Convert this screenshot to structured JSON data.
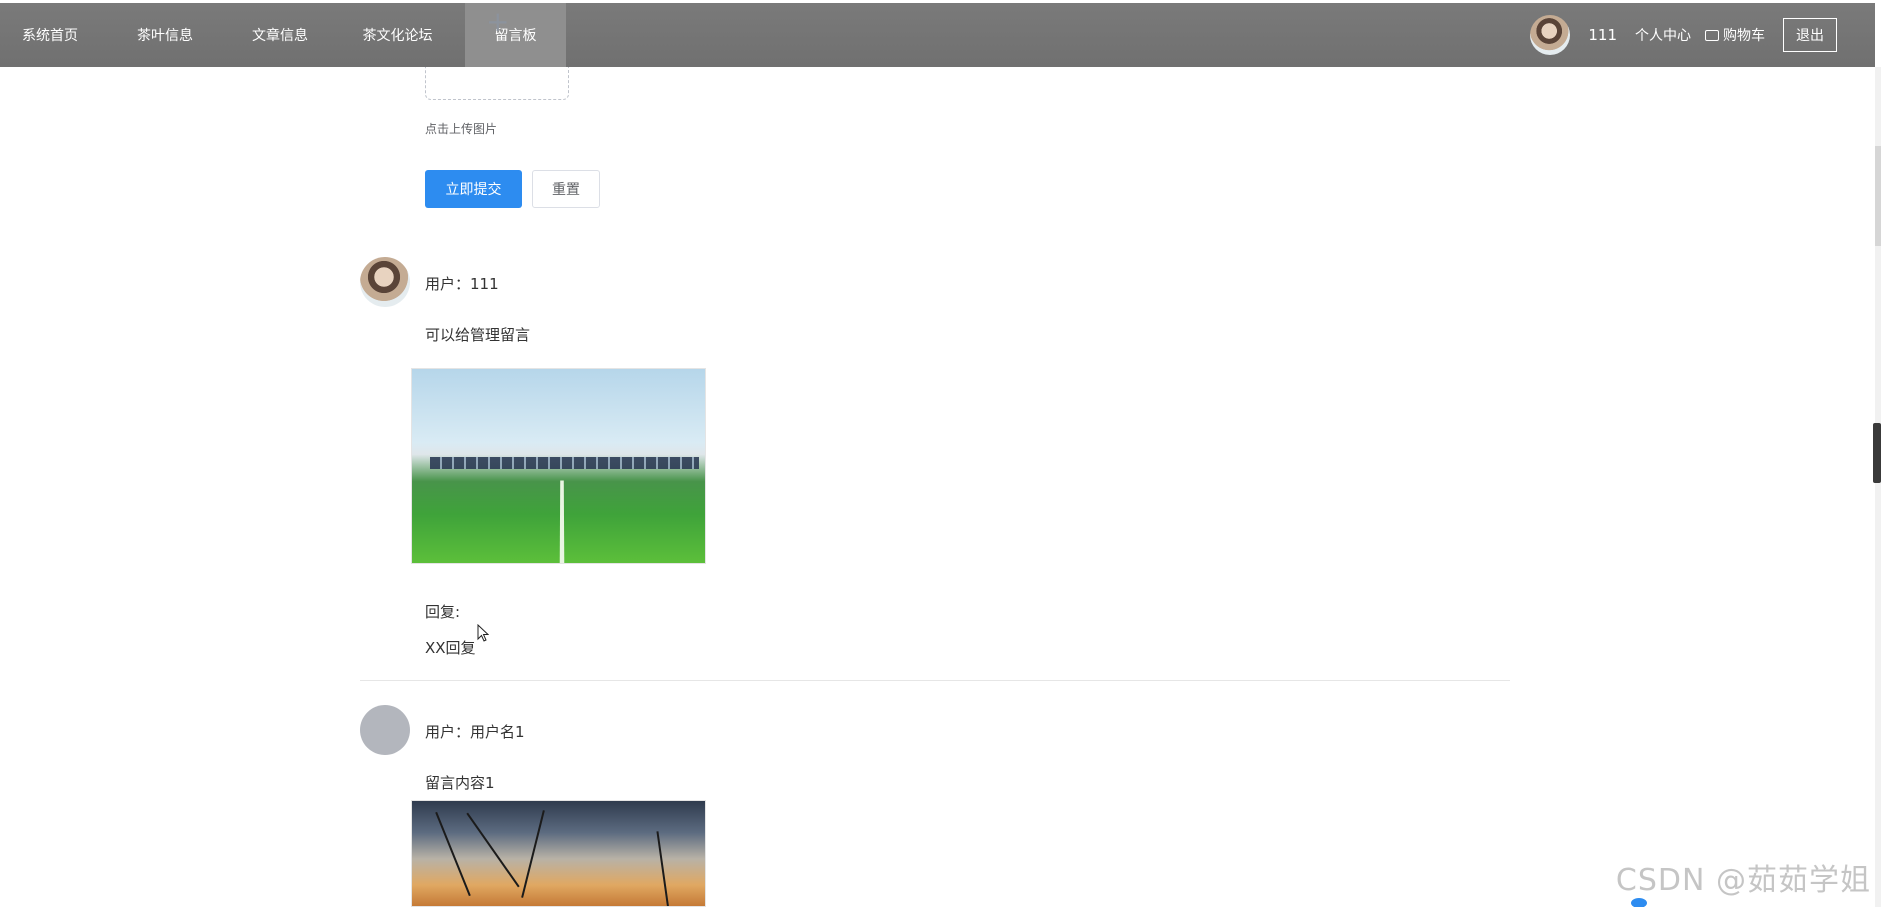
{
  "nav": {
    "items": [
      {
        "label": "系统首页",
        "active": false
      },
      {
        "label": "茶叶信息",
        "active": false
      },
      {
        "label": "文章信息",
        "active": false
      },
      {
        "label": "茶文化论坛",
        "active": false
      },
      {
        "label": "留言板",
        "active": true
      }
    ],
    "username": "111",
    "personal_center": "个人中心",
    "cart": "购物车",
    "logout": "退出"
  },
  "form": {
    "upload_tip": "点击上传图片",
    "submit_label": "立即提交",
    "reset_label": "重置"
  },
  "messages": [
    {
      "user": "用户：111",
      "content": "可以给管理留言",
      "reply_label": "回复:",
      "reply_text": "XX回复"
    },
    {
      "user": "用户：用户名1",
      "content": "留言内容1"
    }
  ],
  "watermark": "CSDN @茹茹学姐",
  "colors": {
    "nav_bg": "#777777",
    "primary": "#2d8cf0"
  }
}
